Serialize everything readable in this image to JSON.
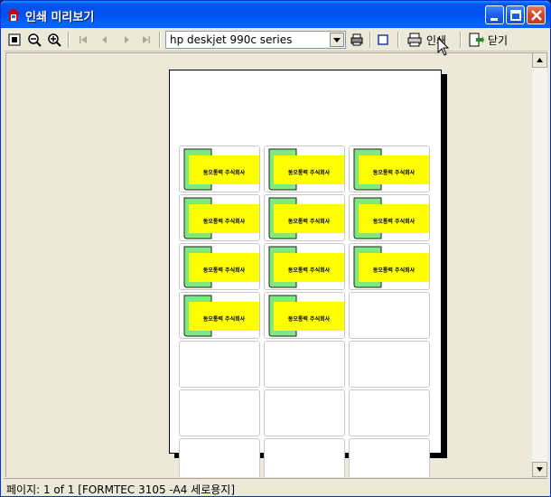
{
  "window": {
    "title": "인쇄 미리보기",
    "minimize_icon": "minimize-icon",
    "maximize_icon": "maximize-icon",
    "close_icon": "close-icon"
  },
  "toolbar": {
    "printer": "hp deskjet 990c series",
    "print_label": "인쇄",
    "close_label": "닫기",
    "icons": [
      "fit-page-icon",
      "zoom-out-icon",
      "zoom-in-icon",
      "first-page-icon",
      "prev-page-icon",
      "next-page-icon",
      "last-page-icon",
      "printer-setup-icon",
      "page-layout-icon",
      "print-icon",
      "close-doc-icon"
    ]
  },
  "sheet": {
    "label_text": "동오통력 주식회사",
    "columns": 3,
    "rows": 7,
    "filled_count": 11
  },
  "status": {
    "text": "페이지: 1 of 1 [FORMTEC 3105 -A4 세로용지]"
  },
  "colors": {
    "label_yellow": "#ffff00",
    "label_green": "#80e880",
    "title_blue": "#0054e3"
  }
}
